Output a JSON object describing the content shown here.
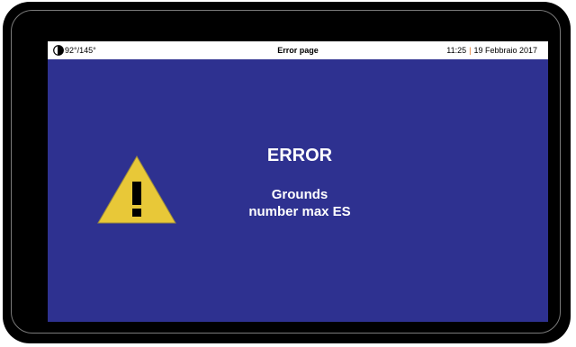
{
  "status_bar": {
    "icon": "compass-icon",
    "angle": "92°/145°",
    "title": "Error page",
    "time": "11:25",
    "separator": "|",
    "date": "19 Febbraio 2017"
  },
  "error": {
    "icon": "warning-icon",
    "title": "ERROR",
    "message_line1": "Grounds",
    "message_line2": "number max ES"
  },
  "colors": {
    "panel_background": "#2e3190",
    "warning_fill": "#e8c838",
    "separator": "#e07020"
  }
}
